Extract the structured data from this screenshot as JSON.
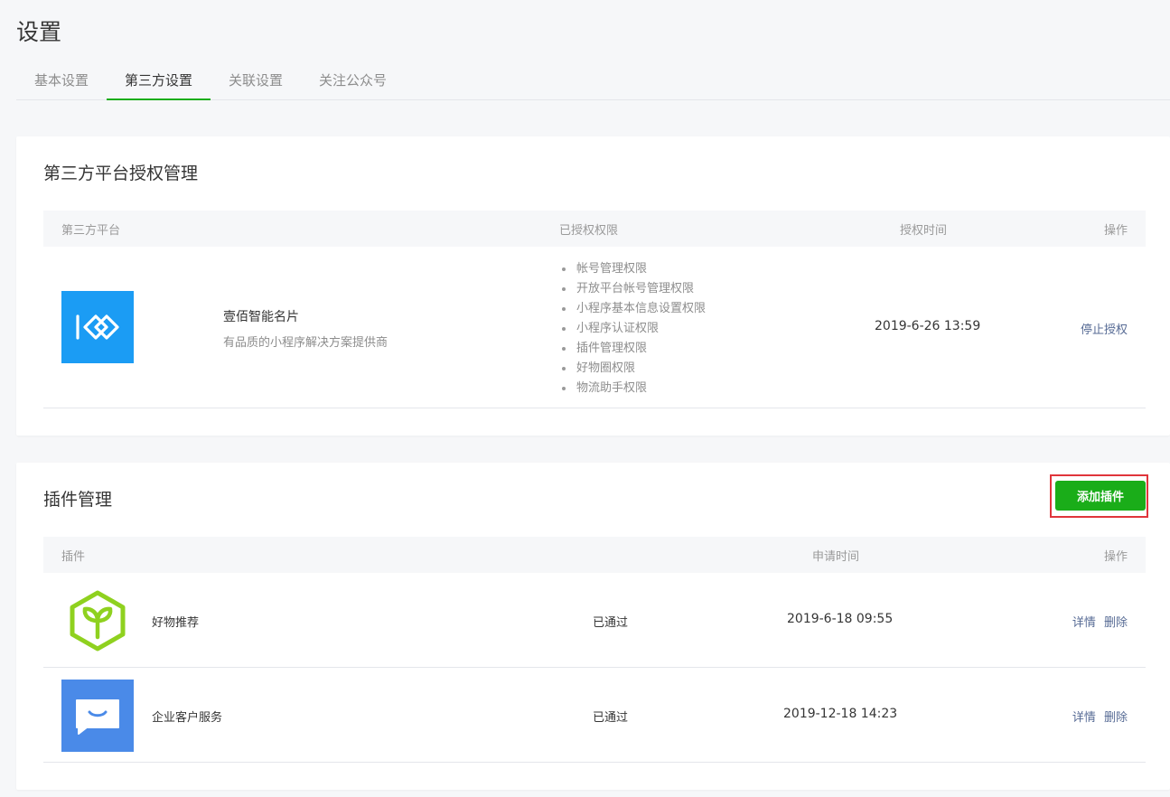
{
  "page": {
    "title": "设置"
  },
  "tabs": [
    {
      "label": "基本设置",
      "active": false
    },
    {
      "label": "第三方设置",
      "active": true
    },
    {
      "label": "关联设置",
      "active": false
    },
    {
      "label": "关注公众号",
      "active": false
    }
  ],
  "auth_section": {
    "title": "第三方平台授权管理",
    "columns": {
      "platform": "第三方平台",
      "permissions": "已授权权限",
      "time": "授权时间",
      "action": "操作"
    },
    "rows": [
      {
        "logo_icon": "infinity-logo-icon",
        "logo_color": "#1b9cf4",
        "name": "壹佰智能名片",
        "description": "有品质的小程序解决方案提供商",
        "permissions": [
          "帐号管理权限",
          "开放平台帐号管理权限",
          "小程序基本信息设置权限",
          "小程序认证权限",
          "插件管理权限",
          "好物圈权限",
          "物流助手权限"
        ],
        "time": "2019-6-26 13:59",
        "action": "停止授权"
      }
    ]
  },
  "plugin_section": {
    "title": "插件管理",
    "add_button": "添加插件",
    "columns": {
      "plugin": "插件",
      "time": "申请时间",
      "action": "操作"
    },
    "rows": [
      {
        "icon": "sprout-hexagon-icon",
        "name": "好物推荐",
        "status": "已通过",
        "time": "2019-6-18 09:55",
        "detail": "详情",
        "delete": "删除"
      },
      {
        "icon": "chat-bubble-icon",
        "name": "企业客户服务",
        "status": "已通过",
        "time": "2019-12-18 14:23",
        "detail": "详情",
        "delete": "删除"
      }
    ]
  },
  "colors": {
    "accent": "#1aad19",
    "link": "#576b95",
    "highlight_border": "#e0353b"
  }
}
